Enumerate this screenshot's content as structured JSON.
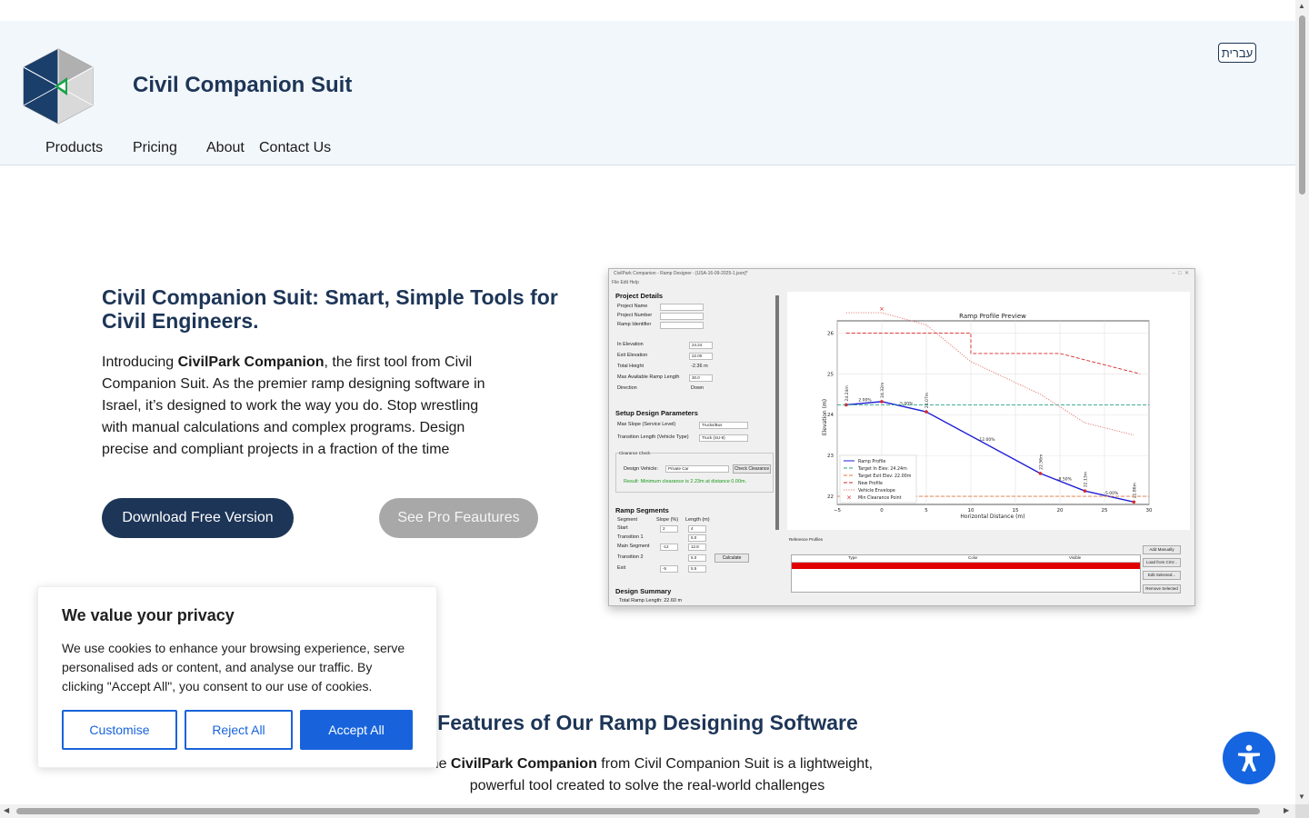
{
  "header": {
    "lang_button": "עברית",
    "brand": "Civil Companion Suit",
    "nav": [
      "Products",
      "Pricing",
      "About",
      "Contact Us"
    ]
  },
  "hero": {
    "title": "Civil Companion Suit: Smart, Simple Tools for Civil Engineers.",
    "text_prefix": "Introducing ",
    "text_bold": "CivilPark Companion",
    "text_suffix": ", the first tool from Civil Companion Suit. As the premier ramp designing software in Israel, it’s designed to work the way you do. Stop wrestling with manual calculations and complex programs. Design precise and compliant projects in a fraction of the time",
    "download_button": "Download Free Version",
    "pro_button": "See Pro Feautures"
  },
  "app_screenshot": {
    "window_title": "CivilPark Companion - Ramp Designer - [USA-16-09-2025-1.json]*",
    "menu": "File    Edit    Help",
    "project_details": {
      "heading": "Project Details",
      "labels": [
        "Project Name",
        "Project Number",
        "Ramp Identifier"
      ]
    },
    "elevations": {
      "in_label": "In Elevation",
      "in_value": "24.24",
      "exit_label": "Exit Elevation",
      "exit_value": "22.00",
      "total_label": "Total Height",
      "total_value": "-2.36 m",
      "max_label": "Max Available Ramp Length",
      "max_value": "30.0",
      "direction_label": "Direction",
      "direction_value": "Down"
    },
    "setup": {
      "heading": "Setup Design Parameters",
      "slope_label": "Max Slope (Service Level)",
      "slope_value": "Trucks/Bus",
      "transition_label": "Transition Length (Vehicle Type)",
      "transition_value": "Truck (SU-9)"
    },
    "clearance": {
      "heading": "Clearance Check",
      "vehicle_label": "Design Vehicle:",
      "vehicle_value": "Private Car",
      "button": "Check Clearance",
      "result": "Result: Minimum clearance is 2.23m at distance 0.00m."
    },
    "segments": {
      "heading": "Ramp Segments",
      "headers": [
        "Segment",
        "Slope (%)",
        "Length (m)"
      ],
      "rows": [
        {
          "name": "Start",
          "slope": "2",
          "length": "4"
        },
        {
          "name": "Transition 1",
          "slope": "",
          "length": "5.0"
        },
        {
          "name": "Main Segment",
          "slope": "-12",
          "length": "12.8"
        },
        {
          "name": "Transition 2",
          "slope": "",
          "length": "5.0"
        },
        {
          "name": "Exit",
          "slope": "-5",
          "length": "5.5"
        }
      ],
      "calculate": "Calculate"
    },
    "summary": {
      "heading": "Design Summary",
      "line": "Total Ramp Length:        22.60 m"
    },
    "reference": {
      "label": "Reference Profiles",
      "columns": [
        "Type",
        "Color",
        "Visible"
      ],
      "buttons": [
        "Add Manually",
        "Load from CSV...",
        "Edit Selected...",
        "Remove Selected"
      ]
    },
    "chart_data": {
      "type": "line",
      "title": "Ramp Profile Preview",
      "xlabel": "Horizontal Distance (m)",
      "ylabel": "Elevation (m)",
      "xlim": [
        -5,
        30
      ],
      "ylim": [
        21.8,
        26.3
      ],
      "xticks": [
        -5,
        0,
        5,
        10,
        15,
        20,
        25,
        30
      ],
      "yticks": [
        22,
        23,
        24,
        25,
        26
      ],
      "grid": true,
      "legend_position": "bottom-left",
      "series": [
        {
          "name": "Ramp Profile",
          "color": "#1f1fd6",
          "style": "solid",
          "x": [
            -4,
            0,
            5,
            17.8,
            22.8,
            28.3
          ],
          "y": [
            24.24,
            24.32,
            24.07,
            22.56,
            22.13,
            21.86
          ]
        },
        {
          "name": "Target In Elev: 24.24m",
          "color": "#2ca089",
          "style": "dashed",
          "x": [
            -5,
            30
          ],
          "y": [
            24.24,
            24.24
          ]
        },
        {
          "name": "Target Exit Elev: 22.00m",
          "color": "#e07a3a",
          "style": "dashed",
          "x": [
            -5,
            30
          ],
          "y": [
            22.0,
            22.0
          ]
        },
        {
          "name": "New Profile",
          "color": "#d62728",
          "style": "dashed",
          "x": [
            -4,
            10,
            10,
            20,
            29
          ],
          "y": [
            26.0,
            26.0,
            25.5,
            25.5,
            25.0
          ]
        },
        {
          "name": "Vehicle Envelope",
          "color": "#e0706a",
          "style": "dotted",
          "x": [
            -4,
            0,
            5,
            10,
            17.8,
            22.8,
            28.3
          ],
          "y": [
            26.5,
            26.5,
            26.2,
            25.3,
            24.5,
            23.8,
            23.5
          ]
        }
      ],
      "min_clearance_point": {
        "x": 0,
        "y": 26.6,
        "label": "Min Clearance Point"
      },
      "point_labels": [
        "24.24m",
        "24.32m",
        "24.07m",
        "22.56m",
        "22.13m",
        "21.86m"
      ],
      "slope_labels": [
        "2.00%",
        "-5.00%",
        "-12.00%",
        "-8.50%",
        "-5.00%"
      ]
    }
  },
  "features": {
    "title": "Features of Our Ramp Designing Software",
    "text_prefix": "The ",
    "text_bold": "CivilPark Companion",
    "text_suffix": " from Civil Companion Suit is a lightweight, powerful tool created to solve the real-world challenges"
  },
  "cookie": {
    "title": "We value your privacy",
    "text": "We use cookies to enhance your browsing experience, serve personalised ads or content, and analyse our traffic. By clicking \"Accept All\", you consent to our use of cookies.",
    "customise": "Customise",
    "reject": "Reject All",
    "accept": "Accept All"
  },
  "icons": {
    "logo": "cube-logo-icon",
    "accessibility": "accessibility-icon"
  },
  "colors": {
    "brand_navy": "#1d3557",
    "accept_blue": "#1863dc",
    "a11y_blue": "#1565e0",
    "header_bg": "#f2f7fb"
  }
}
